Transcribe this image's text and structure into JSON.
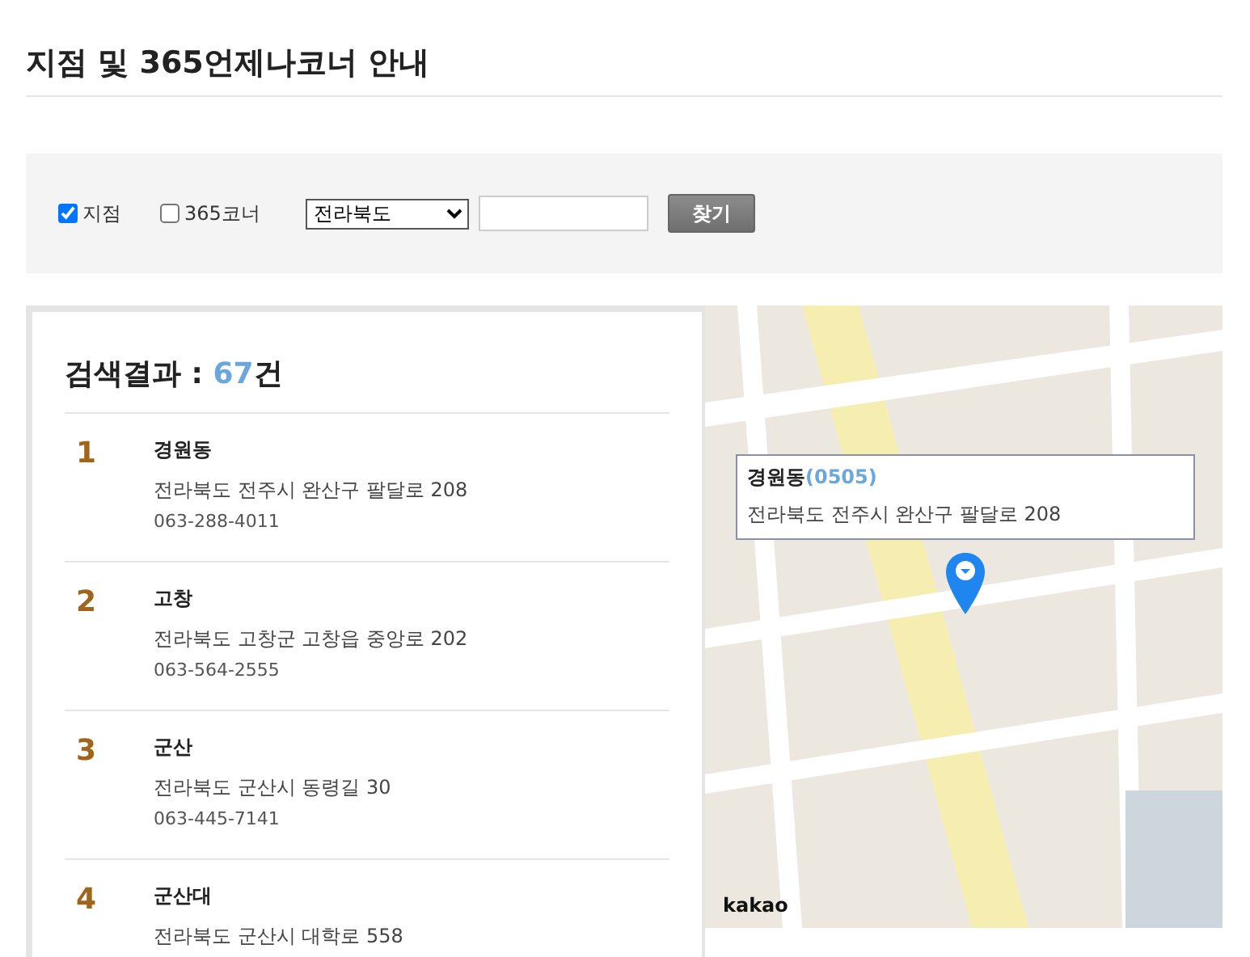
{
  "page_title": "지점 및 365언제나코너 안내",
  "filters": {
    "checkboxes": [
      {
        "label": "지점",
        "checked": true
      },
      {
        "label": "365코너",
        "checked": false
      }
    ],
    "region_select": {
      "value": "전라북도"
    },
    "search_button": "찾기"
  },
  "results": {
    "heading": "검색결과 : ",
    "count": "67",
    "count_unit": "건",
    "items": [
      {
        "number": "1",
        "name": "경원동",
        "address": "전라북도 전주시 완산구 팔달로 208",
        "phone": "063-288-4011"
      },
      {
        "number": "2",
        "name": "고창",
        "address": "전라북도 고창군 고창읍 중앙로 202",
        "phone": "063-564-2555"
      },
      {
        "number": "3",
        "name": "군산",
        "address": "전라북도 군산시 동령길 30",
        "phone": "063-445-7141"
      },
      {
        "number": "4",
        "name": "군산대",
        "address": "전라북도 군산시 대학로 558"
      }
    ]
  },
  "map": {
    "popup": {
      "name": "경원동",
      "code": "(0505)",
      "address": "전라북도 전주시 완산구 팔달로 208"
    },
    "logo": "kakao"
  }
}
